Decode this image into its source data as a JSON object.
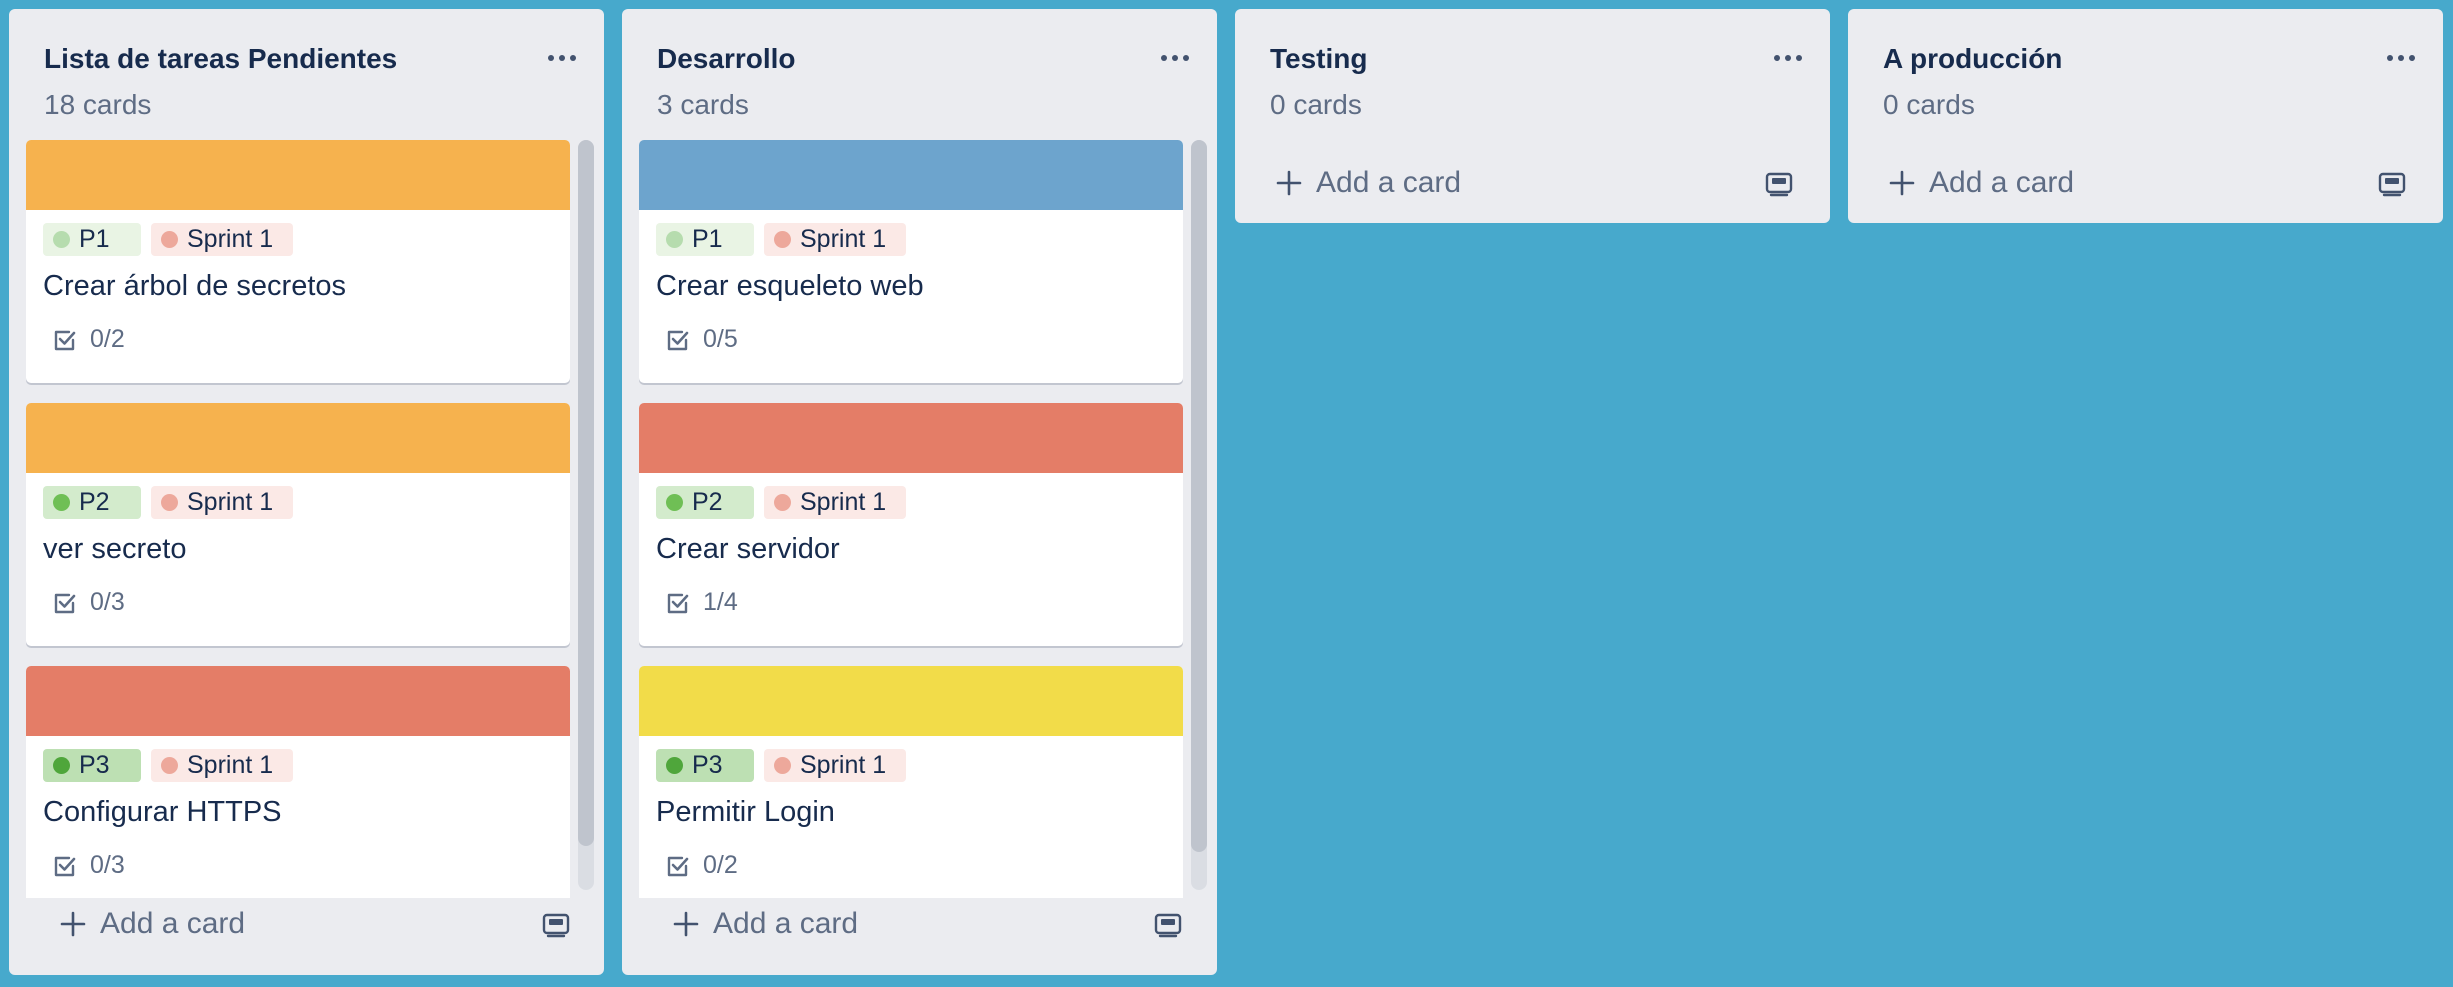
{
  "lists": [
    {
      "title": "Lista de tareas Pendientes",
      "count": "18 cards",
      "add_label": "Add a card",
      "cards": [
        {
          "cover": "#f6b24e",
          "priority": "P1",
          "sprint": "Sprint 1",
          "title": "Crear árbol de secretos",
          "checklist": "0/2"
        },
        {
          "cover": "#f6b24e",
          "priority": "P2",
          "sprint": "Sprint 1",
          "title": "ver secreto",
          "checklist": "0/3"
        },
        {
          "cover": "#e47d67",
          "priority": "P3",
          "sprint": "Sprint 1",
          "title": "Configurar HTTPS",
          "checklist": "0/3"
        }
      ]
    },
    {
      "title": "Desarrollo",
      "count": "3 cards",
      "add_label": "Add a card",
      "cards": [
        {
          "cover": "#6da4cd",
          "priority": "P1",
          "sprint": "Sprint 1",
          "title": "Crear esqueleto web",
          "checklist": "0/5"
        },
        {
          "cover": "#e47d67",
          "priority": "P2",
          "sprint": "Sprint 1",
          "title": "Crear servidor",
          "checklist": "1/4"
        },
        {
          "cover": "#f2dc49",
          "priority": "P3",
          "sprint": "Sprint 1",
          "title": "Permitir Login",
          "checklist": "0/2"
        }
      ]
    },
    {
      "title": "Testing",
      "count": "0 cards",
      "add_label": "Add a card"
    },
    {
      "title": "A producción",
      "count": "0 cards",
      "add_label": "Add a card"
    }
  ],
  "colors": {
    "board_background": "#47a9cc",
    "list_background": "#ebecf0",
    "label_p1_bg": "#e9f4e4",
    "label_p1_dot": "#b6dcae",
    "label_p2_bg": "#d3ebcc",
    "label_p2_dot": "#6fbf55",
    "label_p3_bg": "#bde0b3",
    "label_p3_dot": "#4fa63b",
    "label_sprint_bg": "#fbe9e6",
    "label_sprint_dot": "#eda89b"
  },
  "icons": {
    "list_menu": "ellipsis-icon",
    "checklist": "checkbox-checked-icon",
    "add": "plus-icon",
    "template": "card-template-icon"
  }
}
